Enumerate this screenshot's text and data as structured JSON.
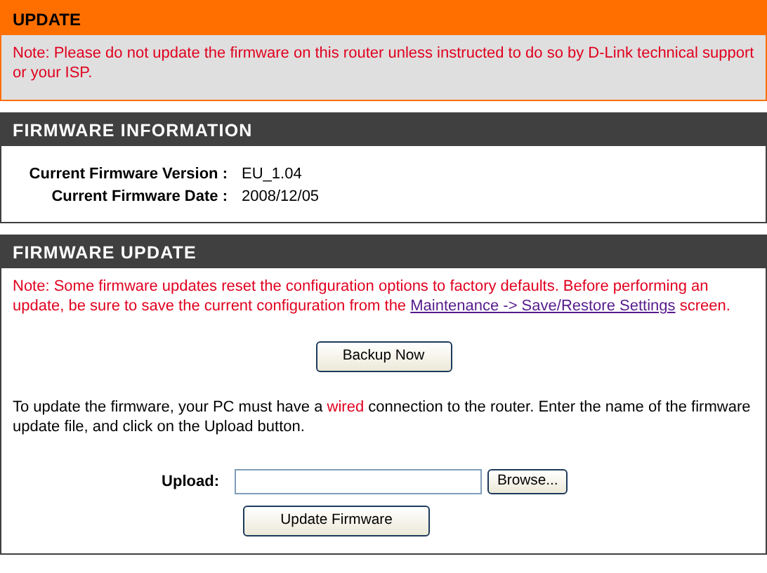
{
  "update": {
    "title": "UPDATE",
    "note": "Note: Please do not update the firmware on this router unless instructed to do so by D-Link technical support or your ISP."
  },
  "firmware_information": {
    "title": "FIRMWARE INFORMATION",
    "rows": [
      {
        "label": "Current Firmware Version :",
        "value": "EU_1.04"
      },
      {
        "label": "Current Firmware Date :",
        "value": "2008/12/05"
      }
    ]
  },
  "firmware_update": {
    "title": "FIRMWARE UPDATE",
    "note": {
      "before": "Note: Some firmware updates reset the configuration options to factory defaults. Before performing an update, be sure to save the current configuration from the ",
      "link": "Maintenance -> Save/Restore Settings",
      "after": " screen."
    },
    "backup_button": "Backup Now",
    "instructions": {
      "before": "To update the firmware, your PC must have a ",
      "highlight": "wired",
      "after": " connection to the router. Enter the name of the firmware update file, and click on the Upload button."
    },
    "upload_label": "Upload:",
    "browse_button": "Browse...",
    "update_button": "Update Firmware"
  }
}
